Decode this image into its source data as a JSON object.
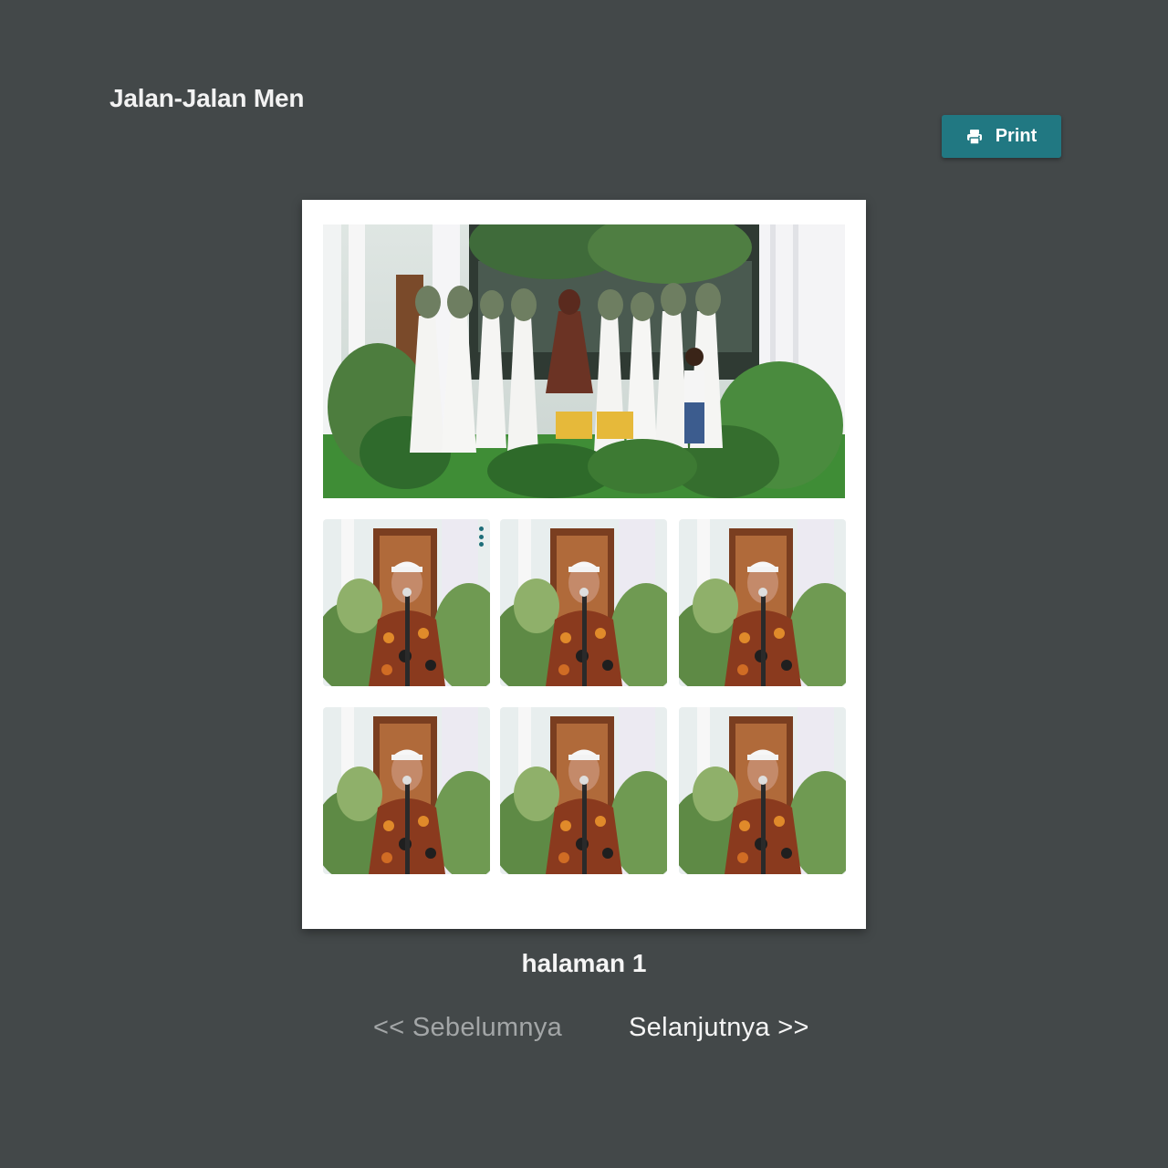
{
  "header": {
    "album_title": "Jalan-Jalan Men",
    "print_label": "Print",
    "print_icon": "printer-icon"
  },
  "sheet": {
    "featured_photo": {
      "label": "group-photo",
      "description_icon": "photo"
    },
    "thumbnails": [
      {
        "label": "portrait-1",
        "has_menu": true
      },
      {
        "label": "portrait-2",
        "has_menu": false
      },
      {
        "label": "portrait-3",
        "has_menu": false
      },
      {
        "label": "portrait-4",
        "has_menu": false
      },
      {
        "label": "portrait-5",
        "has_menu": false
      },
      {
        "label": "portrait-6",
        "has_menu": false
      }
    ],
    "menu_icon": "more-vertical-icon"
  },
  "pagination": {
    "page_label": "halaman 1",
    "prev_label": "<< Sebelumnya",
    "next_label": "Selanjutnya >>",
    "prev_enabled": false,
    "next_enabled": true
  },
  "colors": {
    "background": "#434849",
    "accent": "#217882",
    "text_light": "#f5f5f5",
    "text_disabled": "#a3a6a7"
  }
}
